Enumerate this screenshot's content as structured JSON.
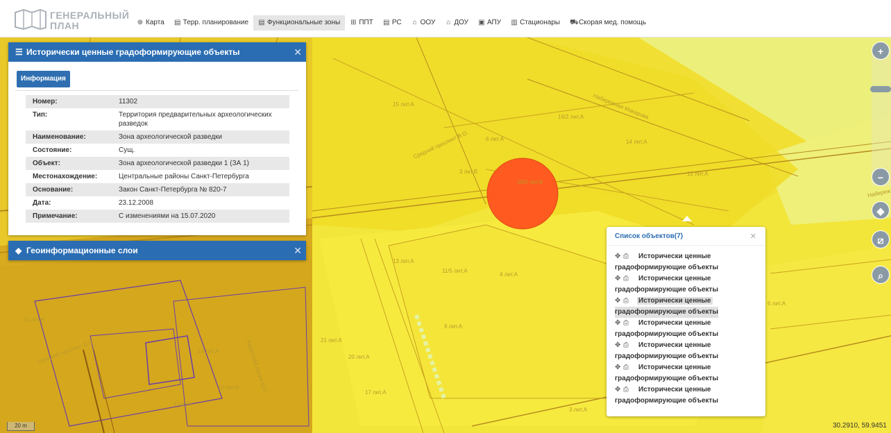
{
  "header": {
    "logo_line1": "ГЕНЕРАЛЬНЫЙ",
    "logo_line2": "ПЛАН",
    "nav": [
      {
        "label": "Карта",
        "icon": "globe-icon",
        "active": false
      },
      {
        "label": "Терр. планирование",
        "icon": "document-icon",
        "active": false
      },
      {
        "label": "Функциональные зоны",
        "icon": "list-icon",
        "active": true
      },
      {
        "label": "ППТ",
        "icon": "grid-icon",
        "active": false
      },
      {
        "label": "РС",
        "icon": "document-icon",
        "active": false
      },
      {
        "label": "ООУ",
        "icon": "school-icon",
        "active": false
      },
      {
        "label": "ДОУ",
        "icon": "kindergarten-icon",
        "active": false
      },
      {
        "label": "АПУ",
        "icon": "clinic-icon",
        "active": false
      },
      {
        "label": "Стационары",
        "icon": "hospital-icon",
        "active": false
      },
      {
        "label": "Скорая мед. помощь",
        "icon": "ambulance-icon",
        "active": false
      }
    ]
  },
  "info_panel": {
    "title": "Исторически ценные градоформирующие объекты",
    "tab": "Информация",
    "rows": [
      {
        "key": "Номер:",
        "value": "11302"
      },
      {
        "key": "Тип:",
        "value": "Территория предварительных археологических разведок"
      },
      {
        "key": "Наименование:",
        "value": "Зона археологической разведки"
      },
      {
        "key": "Состояние:",
        "value": "Сущ."
      },
      {
        "key": "Объект:",
        "value": "Зона археологической разведки 1 (ЗА 1)"
      },
      {
        "key": "Местонахождение:",
        "value": "Центральные районы Санкт-Петербурга"
      },
      {
        "key": "Основание:",
        "value": "Закон Санкт-Петербурга № 820-7"
      },
      {
        "key": "Дата:",
        "value": "23.12.2008"
      },
      {
        "key": "Примечание:",
        "value": "С изменениями на 15.07.2020"
      }
    ]
  },
  "layers_panel": {
    "title": "Геоинформационные слои"
  },
  "objects_popup": {
    "title": "Список объектов(7)",
    "items": [
      {
        "line1": "Исторически ценные",
        "line2": "градоформирующие объекты",
        "selected": false
      },
      {
        "line1": "Исторически ценные",
        "line2": "градоформирующие объекты",
        "selected": false
      },
      {
        "line1": "Исторически ценные",
        "line2": "градоформирующие объекты",
        "selected": true
      },
      {
        "line1": "Исторически ценные",
        "line2": "градоформирующие объекты",
        "selected": false
      },
      {
        "line1": "Исторически ценные",
        "line2": "градоформирующие объекты",
        "selected": false
      },
      {
        "line1": "Исторически ценные",
        "line2": "градоформирующие объекты",
        "selected": false
      },
      {
        "line1": "Исторически ценные",
        "line2": "градоформирующие объекты",
        "selected": false
      }
    ]
  },
  "map": {
    "labels": [
      "15 лит.А",
      "16/2 лит.А",
      "Набережная Макарова",
      "14 лит.А",
      "Средний проспект В.О.",
      "6 лит.А",
      "3 лит.В",
      "16/2 лит.Б",
      "12 лит.А",
      "Набереж",
      "13 лит.А",
      "11/5 лит.А",
      "4 лит.А",
      "6 лит.А",
      "11 лит.А",
      "Средний проспект В.О.",
      "Кадетская линия В.О.",
      "14 лит.А",
      "12 лит.А",
      "21 лит.А",
      "20 лит.А",
      "2 лит.Б",
      "17 лит.А",
      "9 лит.А",
      "3 лит.А"
    ],
    "accent_color": "#f2e33c",
    "marker_color": "#ff5a1f"
  },
  "controls": {
    "zoom_in": "+",
    "zoom_out": "−",
    "scale_label": "20 m",
    "coords": "30.2910, 59.9451"
  }
}
